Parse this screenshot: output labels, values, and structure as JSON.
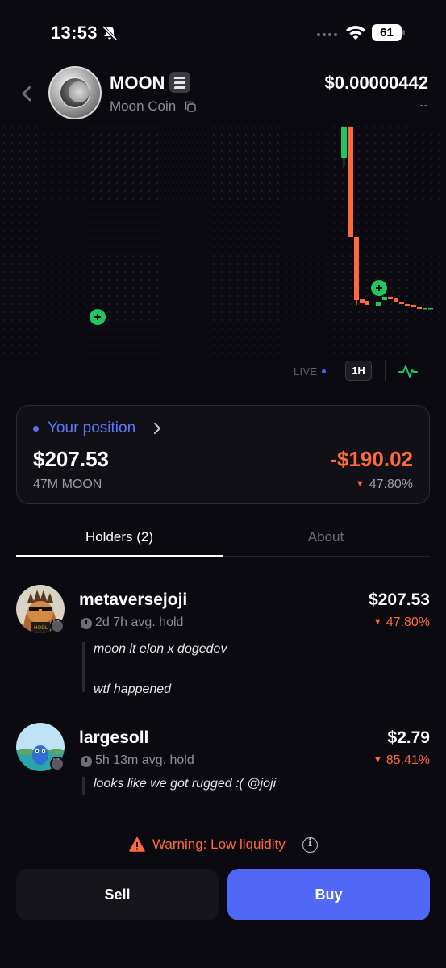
{
  "status_bar": {
    "time": "13:53",
    "battery": "61",
    "icons": [
      "bell-slash-icon",
      "signal-dots-icon",
      "wifi-icon",
      "battery-icon"
    ]
  },
  "header": {
    "symbol": "MOON",
    "name": "Moon Coin",
    "price": "$0.00000442",
    "change": "--",
    "icons": [
      "back-chevron-icon",
      "token-logo",
      "solana-chain-icon",
      "copy-icon"
    ]
  },
  "chart": {
    "live_label": "LIVE",
    "timeframe": "1H",
    "colors": {
      "up": "#22c55e",
      "down": "#ff6a3c"
    }
  },
  "position": {
    "title": "Your position",
    "value": "$207.53",
    "amount": "47M MOON",
    "pnl": "-$190.02",
    "pnl_pct": "47.80%"
  },
  "tabs": [
    {
      "label": "Holders (2)",
      "active": true
    },
    {
      "label": "About",
      "active": false
    }
  ],
  "holders": [
    {
      "name": "metaversejoji",
      "hold": "2d 7h avg. hold",
      "value": "$207.53",
      "pct": "47.80%",
      "comments": [
        "moon it elon x dogedev",
        "wtf happened"
      ]
    },
    {
      "name": "largesoll",
      "hold": "5h 13m avg. hold",
      "value": "$2.79",
      "pct": "85.41%",
      "comments": [
        "looks like we got rugged :( @joji"
      ]
    }
  ],
  "warning": {
    "text": "Warning: Low liquidity"
  },
  "actions": {
    "sell": "Sell",
    "buy": "Buy"
  },
  "colors": {
    "background": "#0b0a10",
    "accent": "#5168f6",
    "negative": "#ff6a3c",
    "positive": "#22c55e"
  }
}
